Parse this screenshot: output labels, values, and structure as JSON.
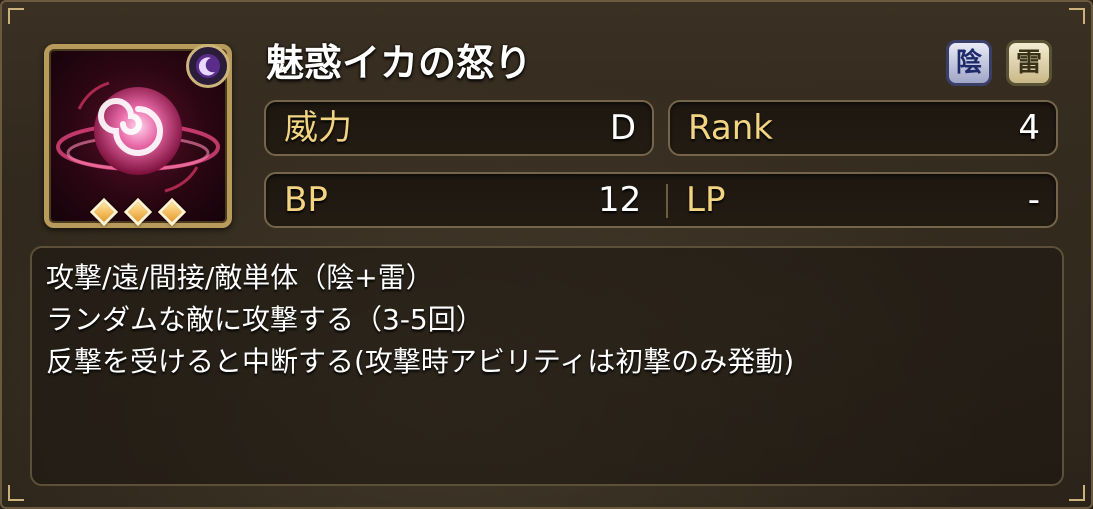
{
  "skill": {
    "name": "魅惑イカの怒り",
    "icon": "crimson-swirl-skill-icon",
    "type_icon": "moon-icon",
    "rank_diamonds": 3,
    "attributes": [
      {
        "label": "陰",
        "name": "yin-attribute-icon"
      },
      {
        "label": "雷",
        "name": "lightning-attribute-icon"
      }
    ]
  },
  "stats": {
    "power_label": "威力",
    "power_value": "D",
    "rank_label": "Rank",
    "rank_value": "4",
    "bp_label": "BP",
    "bp_value": "12",
    "lp_label": "LP",
    "lp_value": "-"
  },
  "description": {
    "line1": "攻撃/遠/間接/敵単体（陰+雷）",
    "line2": "ランダムな敵に攻撃する（3-5回）",
    "line3": "反撃を受けると中断する(攻撃時アビリティは初撃のみ発動)"
  },
  "colors": {
    "stat_label": "#f2d482",
    "frame_gold": "#b89a5a",
    "panel_bg": "#30271c"
  }
}
